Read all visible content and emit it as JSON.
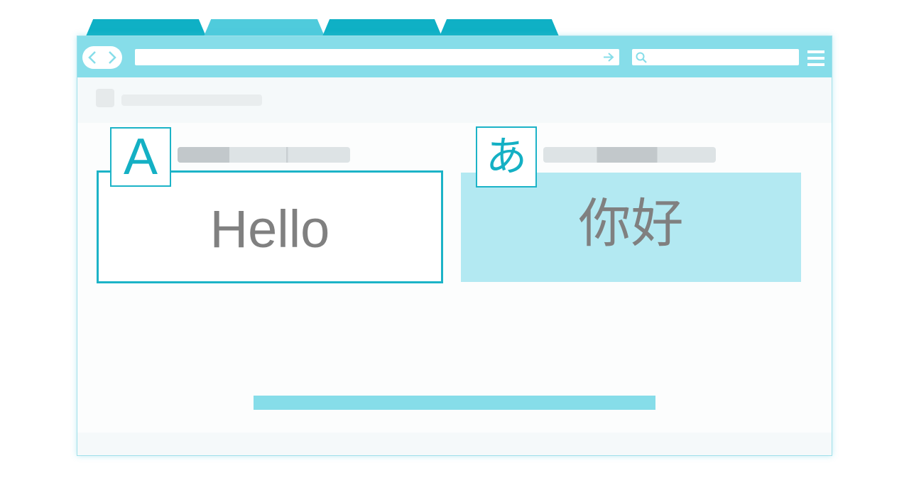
{
  "colors": {
    "accent": "#1cb3c7",
    "toolbar": "#86dde9",
    "tab_dark": "#0fb0c5",
    "tab_light": "#4fcbdc",
    "target_panel_bg": "#b3e9f2",
    "text_gray": "#808080"
  },
  "browser": {
    "tabs": [
      "",
      "",
      "",
      ""
    ],
    "nav": {
      "back_icon": "chevron-left-icon",
      "forward_icon": "chevron-right-icon"
    },
    "address_bar": {
      "value": "",
      "go_icon": "arrow-right-icon"
    },
    "search_bar": {
      "value": "",
      "icon": "search-icon"
    },
    "menu_icon": "hamburger-menu-icon"
  },
  "translator": {
    "source": {
      "language_icon_letter": "A",
      "text": "Hello"
    },
    "target": {
      "language_icon_letter": "あ",
      "text": "你好"
    }
  }
}
